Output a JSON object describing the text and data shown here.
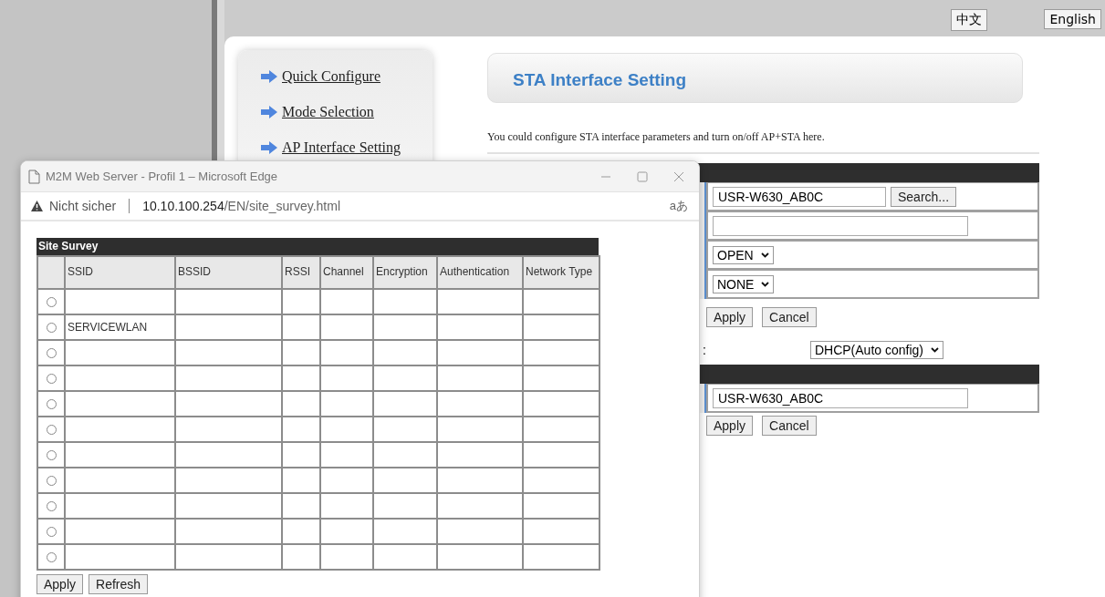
{
  "language_buttons": [
    {
      "label": "中文"
    },
    {
      "label": "English"
    }
  ],
  "sidebar": {
    "items": [
      {
        "label": "Quick Configure"
      },
      {
        "label": "Mode Selection"
      },
      {
        "label": "AP Interface Setting"
      }
    ]
  },
  "page_title": "STA Interface Setting",
  "description": "You could configure STA interface parameters and turn on/off AP+STA here.",
  "sta_form": {
    "rows": [
      {
        "kind": "input-button",
        "value": "USR-W630_AB0C",
        "button": "Search..."
      },
      {
        "kind": "input"
      },
      {
        "kind": "select",
        "value": "OPEN"
      },
      {
        "kind": "select",
        "value": "NONE"
      }
    ],
    "buttons": [
      "Apply",
      "Cancel"
    ]
  },
  "dhcp": {
    "label_tail": ":",
    "value": "DHCP(Auto config)"
  },
  "ap_form": {
    "rows": [
      {
        "kind": "input",
        "value": "USR-W630_AB0C"
      }
    ],
    "buttons": [
      "Apply",
      "Cancel"
    ]
  },
  "popup": {
    "title": "M2M Web Server - Profil 1 – Microsoft Edge",
    "address": {
      "warning": "Nicht sicher",
      "host": "10.10.100.254",
      "path": "/EN/site_survey.html",
      "translate_glyph": "aあ"
    },
    "survey": {
      "title": "Site Survey",
      "columns": [
        "SSID",
        "BSSID",
        "RSSI",
        "Channel",
        "Encryption",
        "Authentication",
        "Network Type"
      ],
      "rows": [
        {
          "selected": false
        },
        {
          "selected": false,
          "ssid": "SERVICEWLAN"
        },
        {
          "selected": false
        },
        {
          "selected": false
        },
        {
          "selected": false
        },
        {
          "selected": false
        },
        {
          "selected": false
        },
        {
          "selected": false
        },
        {
          "selected": false
        },
        {
          "selected": false
        },
        {
          "selected": false
        }
      ]
    },
    "buttons": [
      "Apply",
      "Refresh"
    ]
  }
}
